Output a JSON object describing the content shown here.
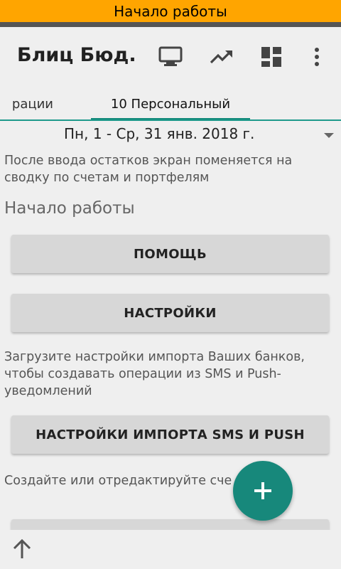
{
  "banner": {
    "text": "Начало работы",
    "color": "#ffa500"
  },
  "appbar": {
    "title": "Блиц Бюд...",
    "icons": [
      "monitor-icon",
      "trending-up-icon",
      "dashboard-icon",
      "more-vert-icon"
    ]
  },
  "tabs": [
    {
      "label": "рации"
    },
    {
      "label": "10 Персональный",
      "selected": true
    }
  ],
  "date_range": {
    "text": "Пн, 1 - Ср, 31 янв. 2018 г."
  },
  "hint1": "После ввода остатков экран поменяется на сводку по счетам и портфелям",
  "section_title": "Начало работы",
  "buttons": {
    "help": "ПОМОЩЬ",
    "settings": "НАСТРОЙКИ",
    "import": "НАСТРОЙКИ ИМПОРТА SMS И PUSH"
  },
  "hint2": "Загрузите настройки импорта Ваших банков, чтобы создавать операции из SMS и Push-уведомлений",
  "hint3": "Создайте или отредактируйте сче сгруппируйте их по портфелям",
  "fab": {
    "icon": "plus-icon",
    "color": "#17887b"
  },
  "bottom_bar": {
    "icon": "arrow-up-icon"
  },
  "accent_color": "#12897a"
}
